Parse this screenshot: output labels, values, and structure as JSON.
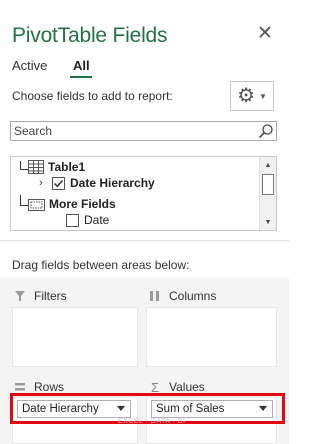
{
  "pane": {
    "title": "PivotTable Fields",
    "close_glyph": "✕",
    "tabs": [
      {
        "label": "Active"
      },
      {
        "label": "All"
      }
    ],
    "choose_label": "Choose fields to add to report:",
    "search": {
      "placeholder": "Search",
      "value": ""
    },
    "tree": {
      "table_name": "Table1",
      "date_hierarchy": "Date Hierarchy",
      "more_fields": "More Fields",
      "date": "Date"
    },
    "drag_label": "Drag fields between areas below:",
    "areas": {
      "filters": "Filters",
      "columns": "Columns",
      "rows": "Rows",
      "values": "Values"
    },
    "rows_pill": "Date Hierarchy",
    "values_pill": "Sum of Sales",
    "watermark": "EXCEL · DATA · BI"
  },
  "colors": {
    "accent": "#217346",
    "highlight": "#e30613"
  },
  "icons": {
    "close": "close-icon",
    "gear": "gear-icon",
    "search": "search-icon",
    "table": "table-icon",
    "filter": "filter-icon",
    "columns": "columns-icon",
    "rows": "rows-icon",
    "values": "sigma-icon"
  }
}
